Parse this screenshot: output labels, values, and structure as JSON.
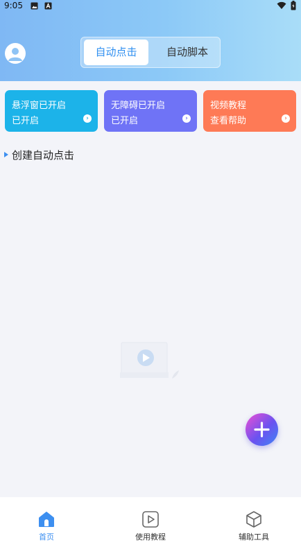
{
  "status_bar": {
    "time": "9:05"
  },
  "tabs": {
    "active": "自动点击",
    "inactive": "自动脚本"
  },
  "cards": [
    {
      "title": "悬浮窗已开启",
      "status": "已开启",
      "color": "#1cb3e9"
    },
    {
      "title": "无障碍已开启",
      "status": "已开启",
      "color": "#6f73f6"
    },
    {
      "title": "视频教程",
      "status": "查看帮助",
      "color": "#fe7a56"
    }
  ],
  "section": {
    "title": "创建自动点击"
  },
  "bottom_nav": [
    {
      "label": "首页",
      "icon": "home-icon",
      "active": true
    },
    {
      "label": "使用教程",
      "icon": "play-icon",
      "active": false
    },
    {
      "label": "辅助工具",
      "icon": "cube-icon",
      "active": false
    }
  ],
  "colors": {
    "accent": "#2f8ff0",
    "background": "#f3f4f9"
  }
}
